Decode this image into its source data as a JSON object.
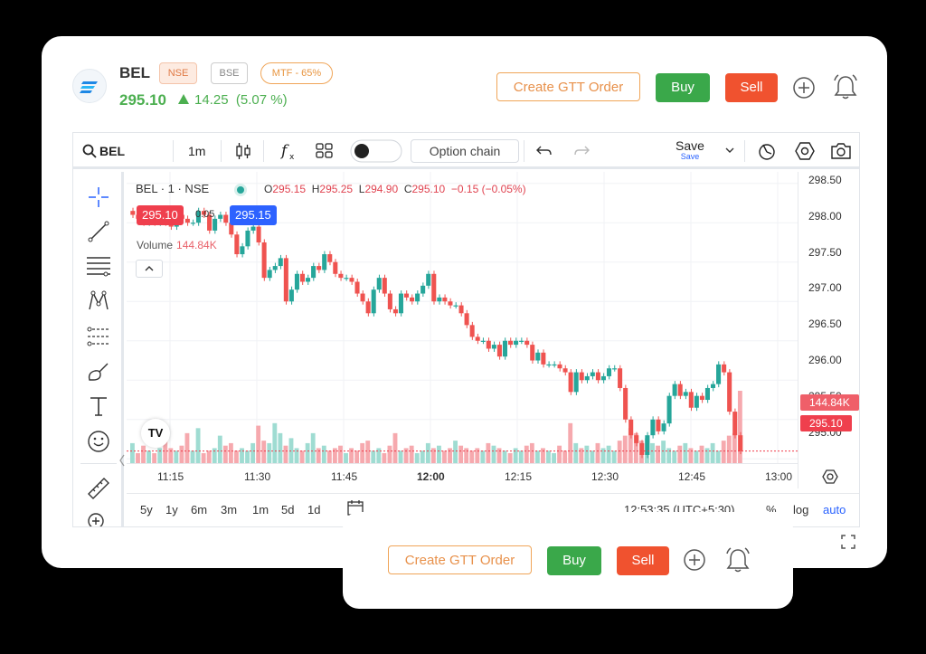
{
  "header": {
    "symbol": "BEL",
    "exchange_nse": "NSE",
    "exchange_bse": "BSE",
    "mtf_label": "MTF - 65%",
    "ltp": "295.10",
    "change": "14.25",
    "change_pct": "(5.07 %)",
    "gtt_label": "Create GTT Order",
    "buy_label": "Buy",
    "sell_label": "Sell",
    "icons": [
      "add-circle-icon",
      "bell-icon"
    ]
  },
  "toolbar": {
    "search_symbol": "BEL",
    "interval": "1m",
    "option_chain": "Option chain",
    "save_label": "Save",
    "save_sub": "Save",
    "icons": [
      "search-icon",
      "candles-icon",
      "indicators-icon",
      "layout-icon",
      "toggle-icon",
      "undo-icon",
      "redo-icon",
      "chevron-down-icon",
      "replay-icon",
      "settings-icon",
      "camera-icon"
    ]
  },
  "legend": {
    "title": "BEL · 1 · NSE",
    "o_label": "O",
    "o": "295.15",
    "h_label": "H",
    "h": "295.25",
    "l_label": "L",
    "l": "294.90",
    "c_label": "C",
    "c": "295.10",
    "chg": "−0.15 (−0.05%)",
    "bid": "295.10",
    "spread": "0.05",
    "ask": "295.15",
    "volume_label": "Volume",
    "volume_value": "144.84K"
  },
  "chart_data": {
    "type": "candlestick",
    "y_ticks": [
      "298.50",
      "298.00",
      "297.50",
      "297.00",
      "296.50",
      "296.00",
      "295.50",
      "295.00"
    ],
    "x_ticks": [
      "11:15",
      "11:30",
      "11:45",
      "12:00",
      "12:15",
      "12:30",
      "12:45",
      "13:00"
    ],
    "ylim": [
      294.9,
      298.6
    ],
    "last_price_tag": "295.10",
    "volume_tag": "144.84K",
    "up_color": "#26a69a",
    "down_color": "#ef5350",
    "closes": [
      298.1,
      298.05,
      298.0,
      298.1,
      298.0,
      298.05,
      298.0,
      297.95,
      298.1,
      298.05,
      298.0,
      298.0,
      298.15,
      298.1,
      297.9,
      298.05,
      298.1,
      298.0,
      297.85,
      297.6,
      297.7,
      297.9,
      297.95,
      297.75,
      297.3,
      297.4,
      297.45,
      297.55,
      297.0,
      297.15,
      297.35,
      297.25,
      297.3,
      297.45,
      297.4,
      297.6,
      297.5,
      297.35,
      297.3,
      297.3,
      297.25,
      297.1,
      297.0,
      296.85,
      297.15,
      297.3,
      297.1,
      296.9,
      296.85,
      297.1,
      297.05,
      297.0,
      297.1,
      297.2,
      297.35,
      297.0,
      297.05,
      297.0,
      296.95,
      296.95,
      296.85,
      296.7,
      296.55,
      296.5,
      296.5,
      296.4,
      296.45,
      296.3,
      296.5,
      296.45,
      296.5,
      296.5,
      296.45,
      296.25,
      296.35,
      296.2,
      296.2,
      296.2,
      296.15,
      296.1,
      295.85,
      296.1,
      296.0,
      296.05,
      296.1,
      296.0,
      296.05,
      296.15,
      296.15,
      295.9,
      295.5,
      295.3,
      295.2,
      295.05,
      295.3,
      295.5,
      295.35,
      295.45,
      295.8,
      295.95,
      295.8,
      295.85,
      295.65,
      295.8,
      295.75,
      295.9,
      295.95,
      296.2,
      296.1,
      295.6,
      295.3,
      295.1
    ],
    "volumes_k": [
      40,
      20,
      35,
      25,
      20,
      30,
      45,
      30,
      25,
      35,
      60,
      25,
      70,
      20,
      25,
      30,
      55,
      35,
      40,
      25,
      30,
      25,
      40,
      75,
      45,
      40,
      80,
      60,
      35,
      50,
      30,
      25,
      40,
      60,
      30,
      35,
      25,
      30,
      35,
      20,
      30,
      25,
      40,
      45,
      25,
      30,
      20,
      35,
      60,
      25,
      30,
      35,
      20,
      25,
      40,
      30,
      35,
      25,
      30,
      45,
      35,
      30,
      25,
      30,
      25,
      40,
      35,
      30,
      25,
      20,
      30,
      25,
      35,
      40,
      25,
      30,
      25,
      20,
      35,
      25,
      80,
      40,
      30,
      35,
      25,
      40,
      30,
      35,
      25,
      45,
      55,
      70,
      60,
      45,
      50,
      40,
      35,
      45,
      30,
      25,
      35,
      40,
      30,
      25,
      35,
      30,
      40,
      25,
      45,
      55,
      60,
      144.84
    ]
  },
  "bottombar": {
    "ranges": [
      "5y",
      "1y",
      "6m",
      "3m",
      "1m",
      "5d",
      "1d"
    ],
    "time": "12:53:35 (UTC+5:30)",
    "pct": "%",
    "log": "log",
    "auto": "auto"
  },
  "popup": {
    "gtt_label": "Create GTT Order",
    "buy_label": "Buy",
    "sell_label": "Sell"
  }
}
